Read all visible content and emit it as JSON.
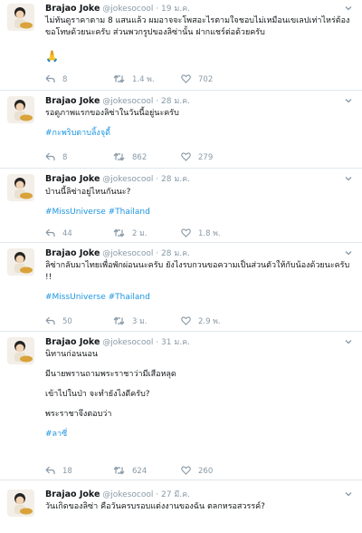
{
  "author": {
    "name": "Brajao Joke",
    "handle": "@jokesocool"
  },
  "tweets": [
    {
      "time": "19 ม.ค.",
      "lines": [
        "ไม่ทันดูราคาตาม 8 แสนแล้ว ผมอาจจะโพสอะไรตามใจชอบไม่เหมือนเขเลปเท่าไหร่ต้อง",
        "ขอโทษด้วยนะครับ ส่วนพวกรูปของลิซ่านั้น ฝากแชร์ต่อด้วยครับ"
      ],
      "emoji": "🙏",
      "hashtags": "",
      "replies": "8",
      "retweets": "1.4 พ.",
      "likes": "702"
    },
    {
      "time": "28 ม.ค.",
      "lines": [
        "รอดูภาพแรกของลิซ่าในวันนี้อยู่นะครับ"
      ],
      "hashtags": "#กะพริบตาบลิ้งจุดี้",
      "replies": "8",
      "retweets": "862",
      "likes": "279"
    },
    {
      "time": "28 ม.ค.",
      "lines": [
        "ป่านนี้ลิซ่าอยู่ไหนกันนะ?"
      ],
      "hashtags": "#MissUniverse #Thailand",
      "replies": "44",
      "retweets": "2 ม.",
      "likes": "1.8 พ."
    },
    {
      "time": "28 ม.ค.",
      "lines": [
        "ลิซ่ากลับมาไทยเพื่อพักผ่อนนะครับ ยังไงรบกวนขอความเป็นส่วนตัวให้กับน้องด้วยนะครับ",
        "!!"
      ],
      "hashtags": "#MissUniverse #Thailand",
      "replies": "50",
      "retweets": "3 ม.",
      "likes": "2.9 พ."
    },
    {
      "time": "31 ม.ค.",
      "lines": [
        "นิทานก่อนนอน",
        "",
        "มีนายพรานถามพระราชาว่ามีเสือหลุด",
        "",
        "เข้าไปในป่า จะทำยังไงดีครับ?",
        "",
        "พระราชาจึงตอบว่า"
      ],
      "hashtags": "#ลาซี่",
      "replies": "18",
      "retweets": "624",
      "likes": "260"
    },
    {
      "time": "27 มี.ค.",
      "lines": [
        "วันเกิดของลิซ่า คือวันครบรอบแต่งงานของฉัน ตลกหรอสวรรค์?"
      ],
      "hashtags": ""
    }
  ],
  "icons": {
    "reply": "reply-icon",
    "retweet": "retweet-icon",
    "like": "heart-icon",
    "caret": "chevron-down-icon"
  },
  "colors": {
    "hashtag": "#1b95e0",
    "meta": "#8899a6",
    "divider": "#e1e8ed"
  }
}
